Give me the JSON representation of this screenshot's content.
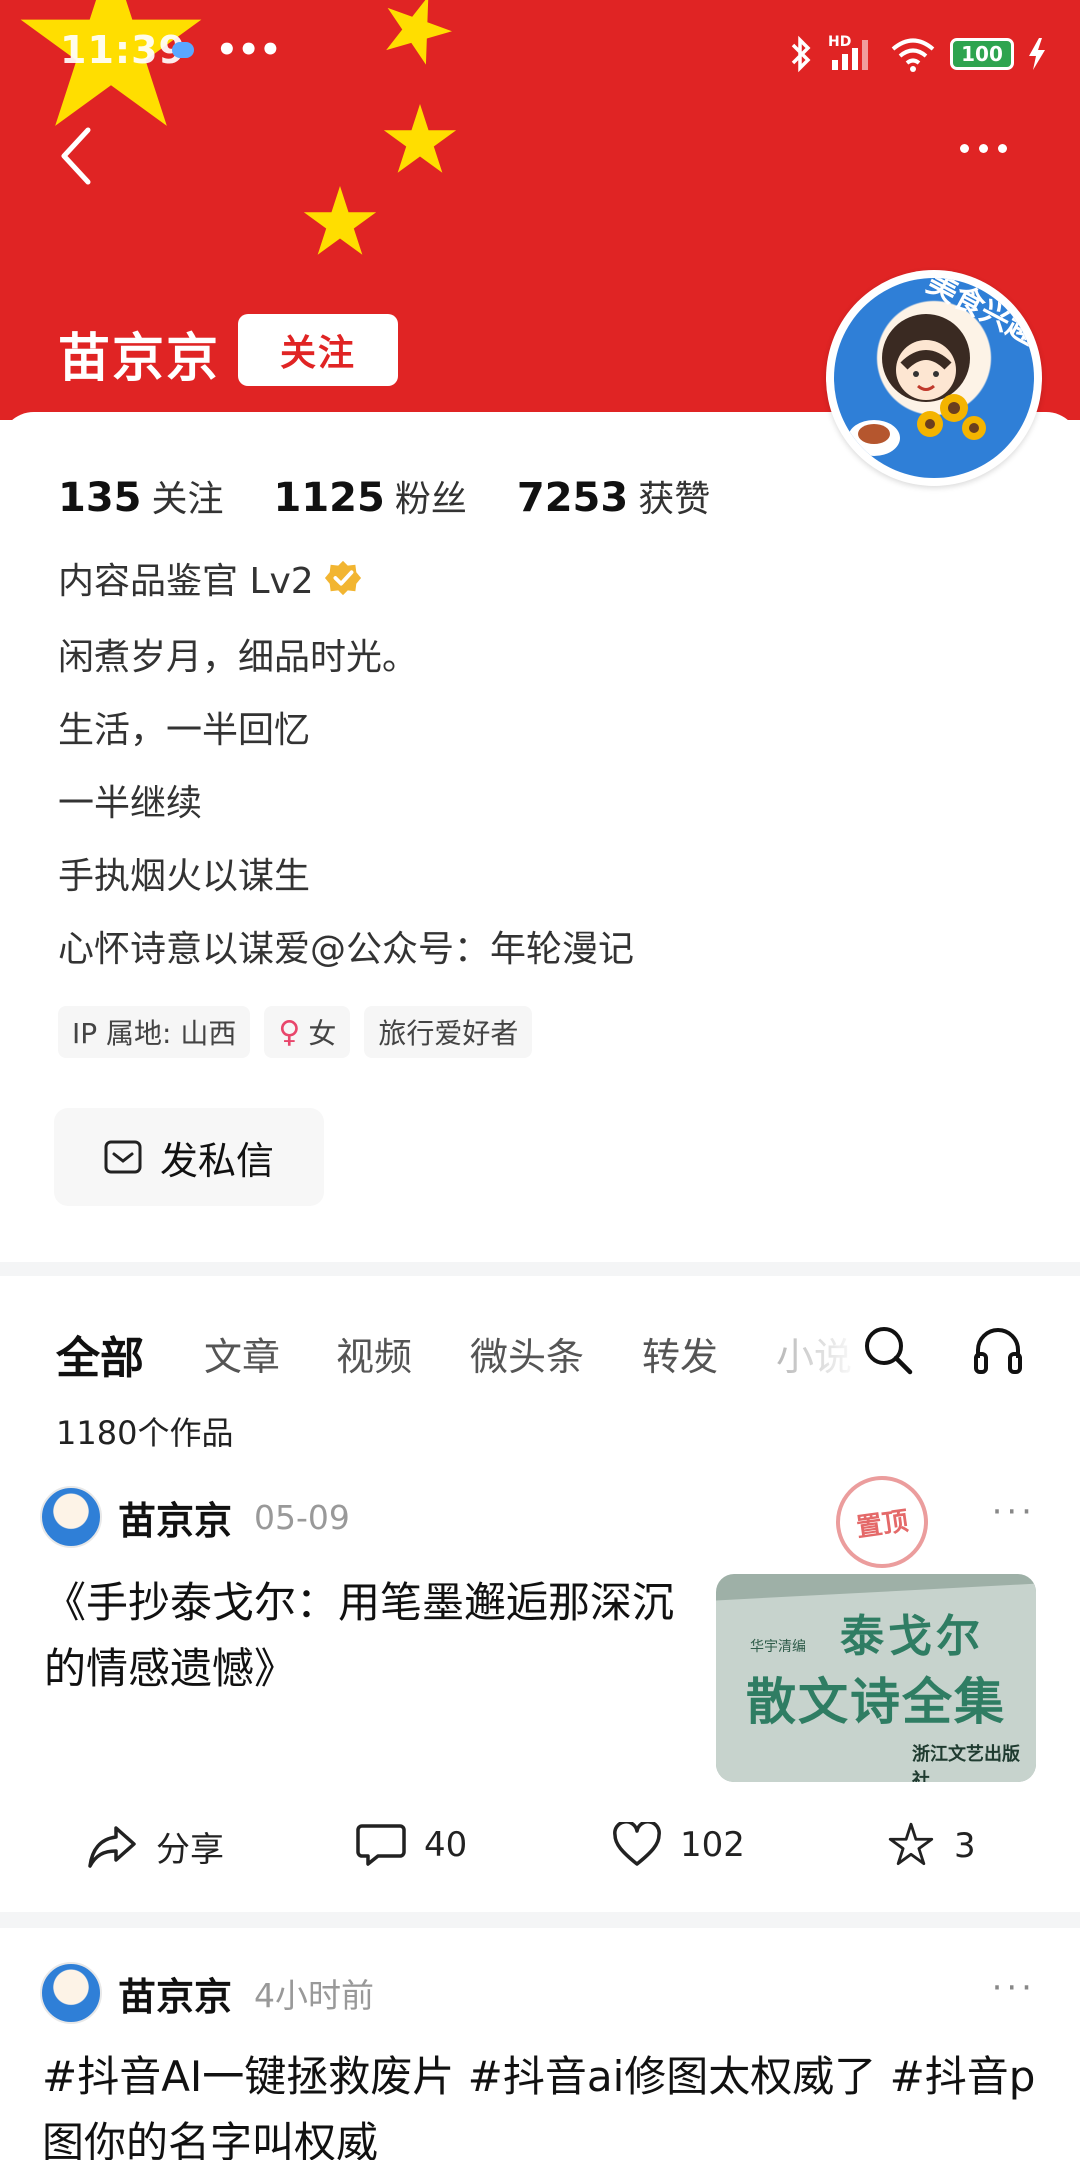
{
  "status_bar": {
    "time": "11:39",
    "dots": "•••",
    "network": "HD",
    "battery": "100"
  },
  "header": {
    "user_name": "苗京京",
    "follow_label": "关注",
    "avatar_tag": "美食兴趣"
  },
  "stats": [
    {
      "num": "135",
      "label": "关注"
    },
    {
      "num": "1125",
      "label": "粉丝"
    },
    {
      "num": "7253",
      "label": "获赞"
    }
  ],
  "badge": "内容品鉴官 Lv2",
  "bio": [
    "闲煮岁月，细品时光。",
    "生活，一半回忆",
    "一半继续",
    "手执烟火以谋生",
    "心怀诗意以谋爱@公众号：年轮漫记"
  ],
  "tags": {
    "ip": "IP 属地: 山西",
    "gender": "女",
    "gender_symbol": "♀",
    "hobby": "旅行爱好者"
  },
  "message_button": "发私信",
  "tabs": [
    "全部",
    "文章",
    "视频",
    "微头条",
    "转发",
    "小说"
  ],
  "works_count": "1180个作品",
  "post1": {
    "author": "苗京京",
    "time": "05-09",
    "more": "···",
    "pin_label": "置顶",
    "title": "《手抄泰戈尔：用笔墨邂逅那深沉的情感遗憾》",
    "thumb": {
      "title1": "泰戈尔",
      "title2": "散文诗全集",
      "small1": "华宇清编",
      "small2": "浙江文艺出版社"
    },
    "share_label": "分享",
    "comments": "40",
    "likes": "102",
    "favorites": "3"
  },
  "post2": {
    "author": "苗京京",
    "time": "4小时前",
    "more": "···",
    "text": "#抖音AI一键拯救废片 #抖音ai修图太权威了 #抖音p图你的名字叫权威"
  },
  "colors": {
    "banner_red": "#e02424",
    "star_yellow": "#ffde00",
    "verify_gold": "#f2b531"
  },
  "icons": [
    "back-arrow-icon",
    "more-icon",
    "verify-icon",
    "mail-icon",
    "search-icon",
    "headphones-icon",
    "share-icon",
    "comment-icon",
    "heart-icon",
    "star-icon"
  ]
}
